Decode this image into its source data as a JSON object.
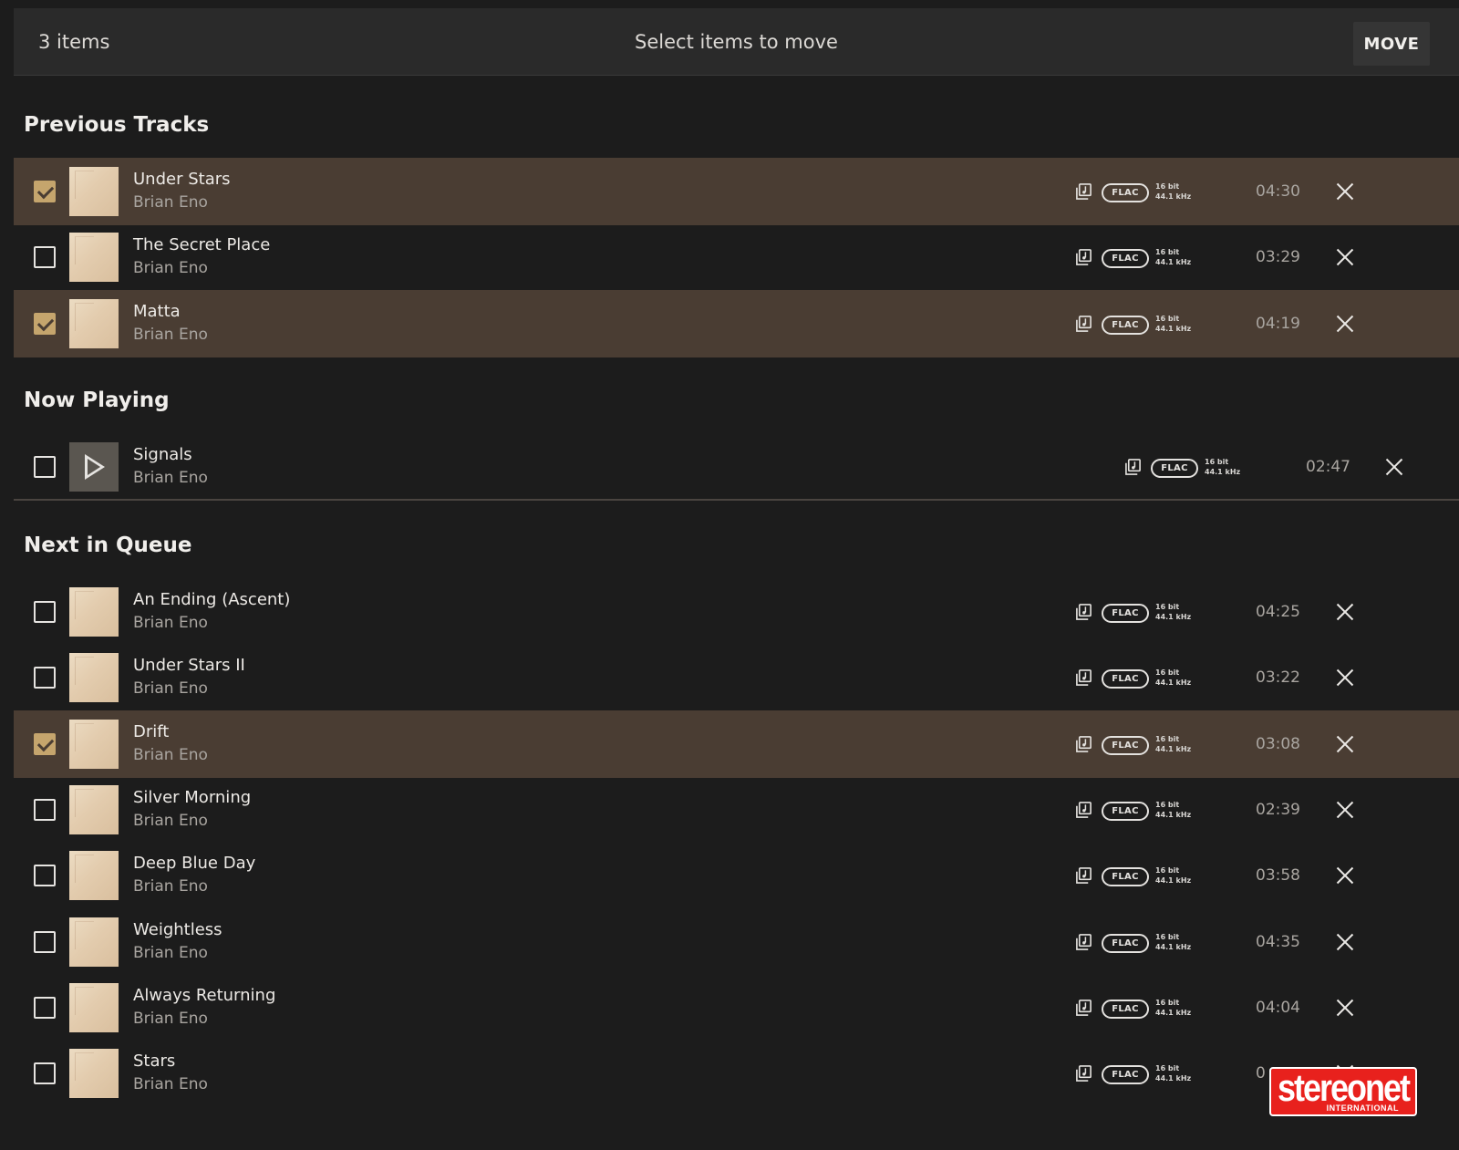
{
  "header": {
    "item_count": "3 items",
    "title": "Select items to move",
    "move_label": "MOVE"
  },
  "sections": {
    "previous": "Previous Tracks",
    "now_playing": "Now Playing",
    "next": "Next in Queue"
  },
  "tracks": [
    {
      "title": "Under Stars",
      "artist": "Brian Eno",
      "format": "FLAC",
      "bit": "16 bit",
      "rate": "44.1 kHz",
      "duration": "04:30",
      "checked": true
    },
    {
      "title": "The Secret Place",
      "artist": "Brian Eno",
      "format": "FLAC",
      "bit": "16 bit",
      "rate": "44.1 kHz",
      "duration": "03:29",
      "checked": false
    },
    {
      "title": "Matta",
      "artist": "Brian Eno",
      "format": "FLAC",
      "bit": "16 bit",
      "rate": "44.1 kHz",
      "duration": "04:19",
      "checked": true
    },
    {
      "title": "Signals",
      "artist": "Brian Eno",
      "format": "FLAC",
      "bit": "16 bit",
      "rate": "44.1 kHz",
      "duration": "02:47",
      "checked": false
    },
    {
      "title": "An Ending (Ascent)",
      "artist": "Brian Eno",
      "format": "FLAC",
      "bit": "16 bit",
      "rate": "44.1 kHz",
      "duration": "04:25",
      "checked": false
    },
    {
      "title": "Under Stars II",
      "artist": "Brian Eno",
      "format": "FLAC",
      "bit": "16 bit",
      "rate": "44.1 kHz",
      "duration": "03:22",
      "checked": false
    },
    {
      "title": "Drift",
      "artist": "Brian Eno",
      "format": "FLAC",
      "bit": "16 bit",
      "rate": "44.1 kHz",
      "duration": "03:08",
      "checked": true
    },
    {
      "title": "Silver Morning",
      "artist": "Brian Eno",
      "format": "FLAC",
      "bit": "16 bit",
      "rate": "44.1 kHz",
      "duration": "02:39",
      "checked": false
    },
    {
      "title": "Deep Blue Day",
      "artist": "Brian Eno",
      "format": "FLAC",
      "bit": "16 bit",
      "rate": "44.1 kHz",
      "duration": "03:58",
      "checked": false
    },
    {
      "title": "Weightless",
      "artist": "Brian Eno",
      "format": "FLAC",
      "bit": "16 bit",
      "rate": "44.1 kHz",
      "duration": "04:35",
      "checked": false
    },
    {
      "title": "Always Returning",
      "artist": "Brian Eno",
      "format": "FLAC",
      "bit": "16 bit",
      "rate": "44.1 kHz",
      "duration": "04:04",
      "checked": false
    },
    {
      "title": "Stars",
      "artist": "Brian Eno",
      "format": "FLAC",
      "bit": "16 bit",
      "rate": "44.1 kHz",
      "duration": "0",
      "checked": false
    }
  ],
  "icons": {
    "library": "library-music-icon",
    "remove": "close-icon",
    "play": "play-icon"
  },
  "colors": {
    "background": "#1c1c1c",
    "header_bar": "#2a2a2a",
    "selected_row": "#4a3d33",
    "checkbox_checked": "#c5a56d",
    "watermark": "#e8211d"
  },
  "watermark": {
    "brand": "stereonet",
    "sub": "INTERNATIONAL"
  }
}
